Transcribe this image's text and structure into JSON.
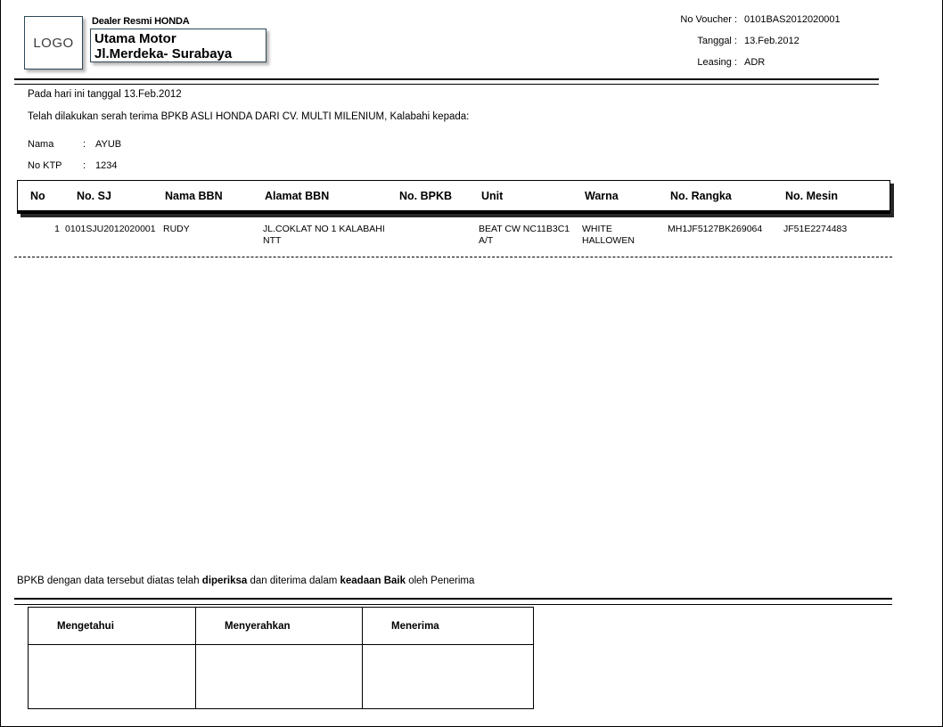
{
  "header": {
    "logo_text": "LOGO",
    "dealer_tagline": "Dealer Resmi HONDA",
    "dealer_name": "Utama Motor",
    "dealer_address": "Jl.Merdeka- Surabaya",
    "meta": [
      {
        "label": "No Voucher :",
        "value": "0101BAS2012020001"
      },
      {
        "label": "Tanggal :",
        "value": "13.Feb.2012"
      },
      {
        "label": "Leasing :",
        "value": "ADR"
      }
    ]
  },
  "body": {
    "intro_date": "Pada hari ini tanggal    13.Feb.2012",
    "intro_text": "Telah dilakukan serah terima BPKB ASLI HONDA DARI CV. MULTI MILENIUM, Kalabahi kepada:",
    "fields": [
      {
        "label": "Nama",
        "colon": ":",
        "value": "AYUB"
      },
      {
        "label": "No KTP",
        "colon": ":",
        "value": "1234"
      }
    ]
  },
  "table": {
    "columns": [
      "No",
      "No. SJ",
      "Nama BBN",
      "Alamat BBN",
      "No. BPKB",
      "Unit",
      "Warna",
      "No. Rangka",
      "No. Mesin"
    ],
    "rows": [
      {
        "no": "1",
        "no_sj": "0101SJU2012020001",
        "nama_bbn": "RUDY",
        "alamat_bbn": "JL.COKLAT NO 1 KALABAHI\nNTT",
        "no_bpkb": "",
        "unit": "BEAT CW NC11B3C1\nA/T",
        "warna": "WHITE\nHALLOWEN",
        "no_rangka": "MH1JF5127BK269064",
        "no_mesin": "JF51E2274483"
      }
    ]
  },
  "footer": {
    "note_part1": "BPKB dengan data tersebut diatas telah ",
    "note_bold1": "diperiksa",
    "note_part2": " dan diterima dalam ",
    "note_bold2": "keadaan Baik",
    "note_part3": " oleh Penerima",
    "signature_columns": [
      "Mengetahui",
      "Menyerahkan",
      "Menerima"
    ]
  }
}
